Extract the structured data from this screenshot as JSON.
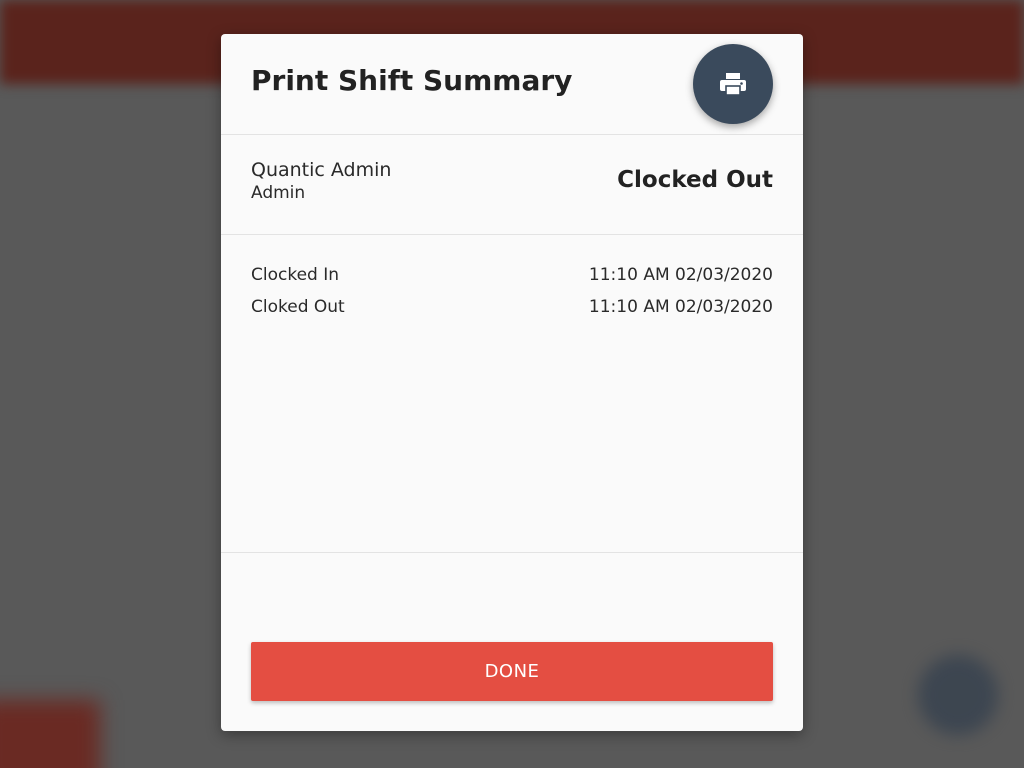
{
  "dialog": {
    "title": "Print Shift Summary",
    "print_button_icon": "printer-icon"
  },
  "user": {
    "name": "Quantic Admin",
    "role": "Admin",
    "status": "Clocked Out"
  },
  "times": [
    {
      "label": "Clocked In",
      "value": "11:10 AM 02/03/2020"
    },
    {
      "label": "Cloked Out",
      "value": "11:10 AM 02/03/2020"
    }
  ],
  "actions": {
    "done_label": "DONE"
  },
  "colors": {
    "accent": "#e44e42",
    "print_button": "#3a4a5c",
    "header_bg": "#5a231c",
    "overlay": "#595959"
  }
}
